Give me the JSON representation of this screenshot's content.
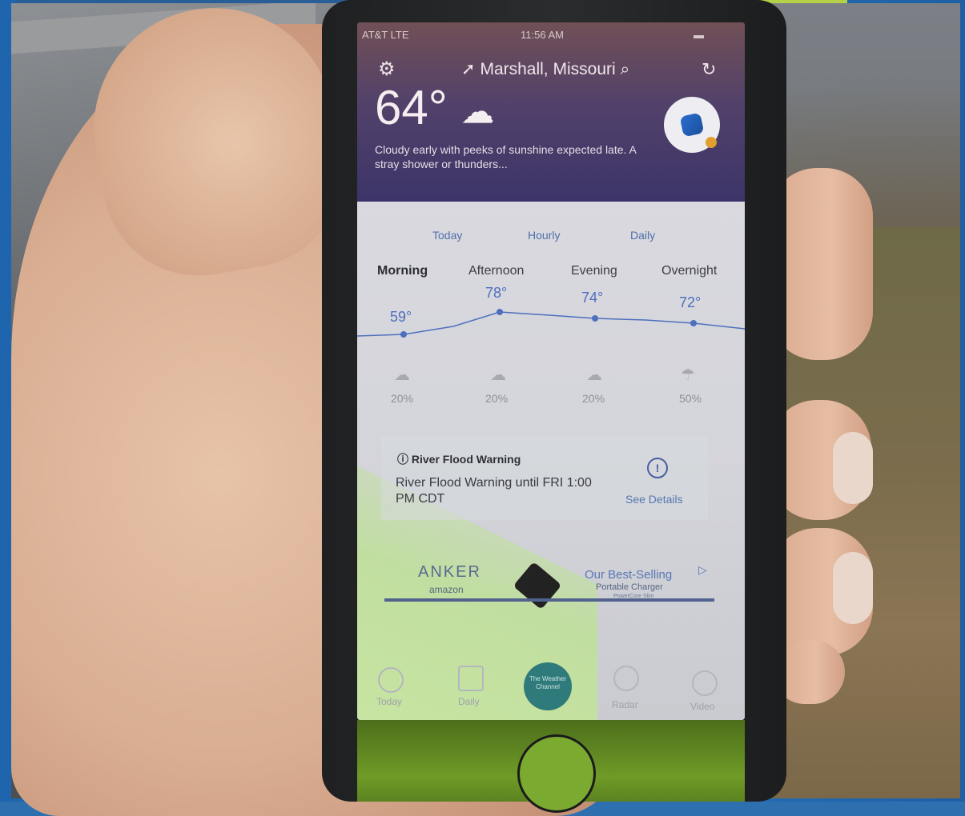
{
  "status": {
    "carrier": "AT&T  LTE",
    "time": "11:56 AM"
  },
  "header": {
    "location": "Marshall, Missouri",
    "current_temp": "64°",
    "description": "Cloudy early with peeks of sunshine expected late. A stray shower or thunders..."
  },
  "tabs": [
    "Today",
    "Hourly",
    "Daily"
  ],
  "periods": [
    {
      "name": "Morning",
      "temp": "59°",
      "precip": "20%"
    },
    {
      "name": "Afternoon",
      "temp": "78°",
      "precip": "20%"
    },
    {
      "name": "Evening",
      "temp": "74°",
      "precip": "20%"
    },
    {
      "name": "Overnight",
      "temp": "72°",
      "precip": "50%"
    }
  ],
  "alert": {
    "title": "River Flood Warning",
    "text": "River Flood Warning until FRI 1:00 PM CDT",
    "action": "See Details"
  },
  "ad": {
    "brand": "ANKER",
    "retailer": "amazon",
    "headline": "Our Best-Selling",
    "line2": "Portable Charger",
    "line3": "PowerCore Slim"
  },
  "tabbar": {
    "items": [
      "Today",
      "Daily",
      "Radar",
      "Video"
    ],
    "brand": "The Weather Channel"
  },
  "colors": {
    "header_top": "#715056",
    "header_bottom": "#3c3468",
    "accent": "#4d6fbd",
    "brand_badge": "#2f7a7a"
  }
}
